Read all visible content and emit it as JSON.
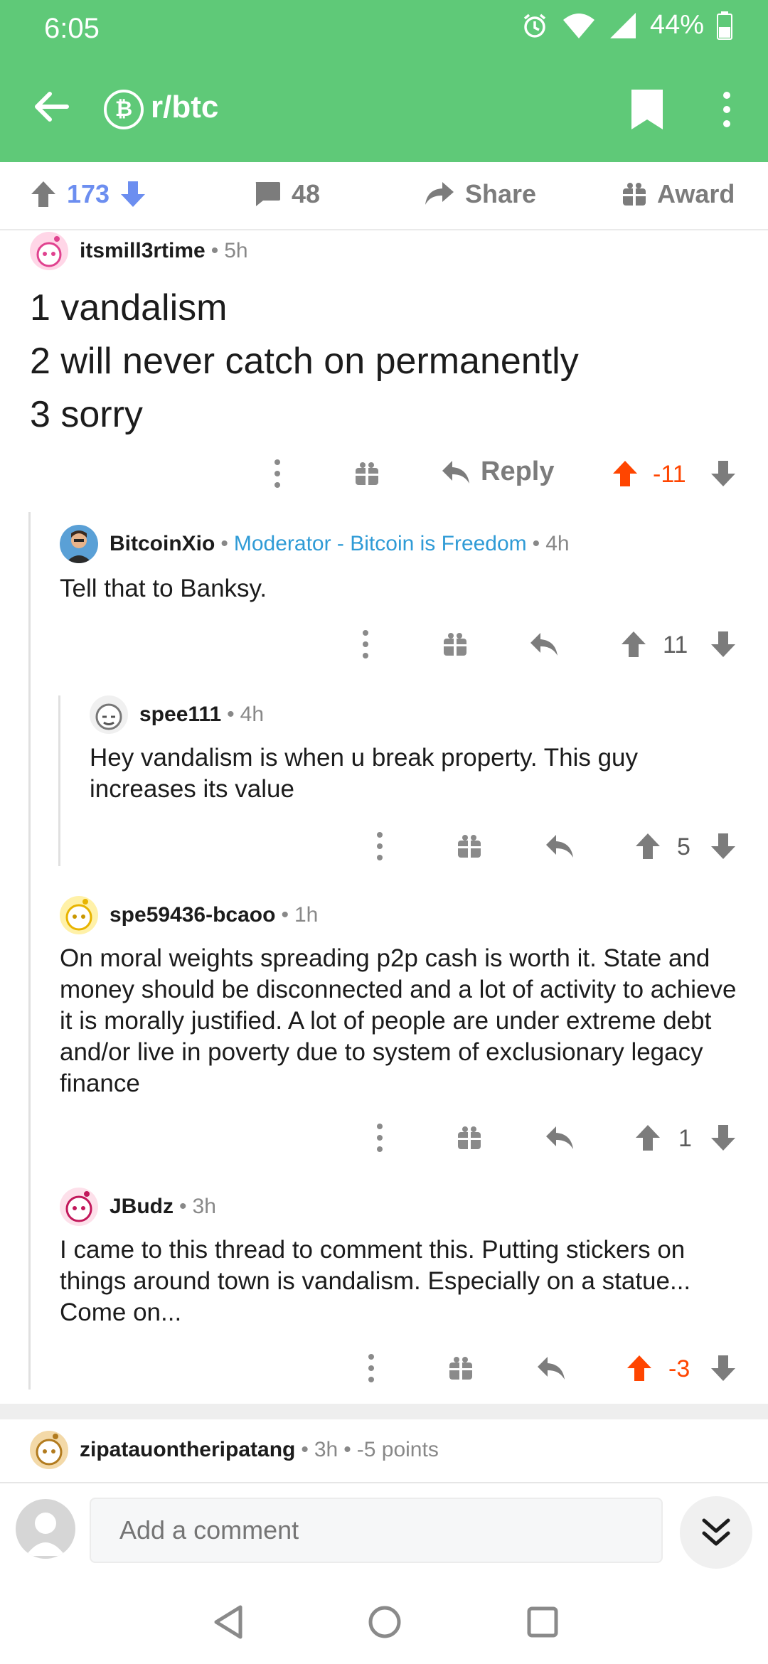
{
  "status": {
    "time": "6:05",
    "battery": "44%"
  },
  "header": {
    "subreddit": "r/btc",
    "sub_icon_glyph": "₿"
  },
  "post_actions": {
    "score": "173",
    "comments": "48",
    "share": "Share",
    "award": "Award"
  },
  "comments": [
    {
      "author": "itsmill3rtime",
      "age": "5h",
      "lines": [
        "1 vandalism",
        "2 will never catch on permanently",
        "3 sorry"
      ],
      "reply_label": "Reply",
      "score": "-11",
      "upvoted": true
    },
    {
      "author": "BitcoinXio",
      "flair": "Moderator - Bitcoin is Freedom",
      "age": "4h",
      "body": "Tell that to Banksy.",
      "score": "11"
    },
    {
      "author": "spee111",
      "age": "4h",
      "body": "Hey vandalism is when u break property. This guy increases its value",
      "score": "5"
    },
    {
      "author": "spe59436-bcaoo",
      "age": "1h",
      "body": "On moral weights spreading p2p cash is worth it. State and money should be disconnected and a lot of activity to achieve it is morally justified. A lot of people are under extreme debt and/or live in poverty due to system of exclusionary legacy finance",
      "score": "1"
    },
    {
      "author": "JBudz",
      "age": "3h",
      "body": "I came to this thread to comment this. Putting stickers on things around town is vandalism. Especially on a statue... Come on...",
      "score": "-3",
      "upvoted": true
    },
    {
      "author": "zipatauontheripatang",
      "age": "3h",
      "points": "-5 points"
    }
  ],
  "composer": {
    "placeholder": "Add a comment"
  },
  "colors": {
    "brand": "#5fc978",
    "upvote": "#ff4500",
    "score_blue": "#6c8ef0",
    "flair": "#2f9bd6"
  }
}
